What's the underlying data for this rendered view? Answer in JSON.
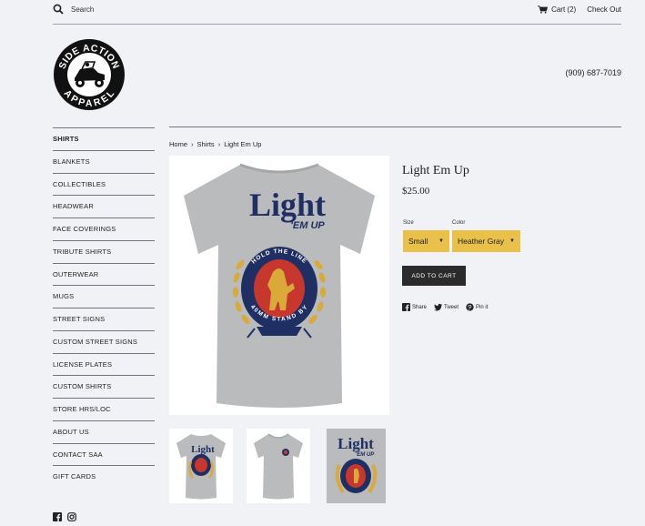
{
  "header": {
    "search_label": "Search",
    "cart_label": "Cart (2)",
    "checkout_label": "Check Out"
  },
  "store": {
    "logo_text_top": "SIDE ACTION",
    "logo_text_bottom": "APPAREL",
    "phone": "(909) 687-7019"
  },
  "sidebar": {
    "items": [
      {
        "label": "SHIRTS",
        "active": true
      },
      {
        "label": "BLANKETS"
      },
      {
        "label": "COLLECTIBLES"
      },
      {
        "label": "HEADWEAR"
      },
      {
        "label": "FACE COVERINGS"
      },
      {
        "label": "TRIBUTE SHIRTS"
      },
      {
        "label": "OUTERWEAR"
      },
      {
        "label": "MUGS"
      },
      {
        "label": "STREET SIGNS"
      },
      {
        "label": "CUSTOM STREET SIGNS"
      },
      {
        "label": "LICENSE PLATES"
      },
      {
        "label": "CUSTOM SHIRTS"
      },
      {
        "label": "STORE HRS/LOC"
      },
      {
        "label": "ABOUT US"
      },
      {
        "label": "CONTACT SAA"
      },
      {
        "label": "GIFT CARDS"
      }
    ],
    "social": [
      "facebook-icon",
      "instagram-icon"
    ]
  },
  "breadcrumb": {
    "home": "Home",
    "sep": "›",
    "category": "Shirts",
    "current": "Light Em Up"
  },
  "product": {
    "title": "Light Em Up",
    "price": "$25.00",
    "graphic_text_main": "Light",
    "graphic_text_sub": "'EM UP",
    "graphic_ring_top": "HOLD THE LINE",
    "graphic_ring_bottom": "40MM STAND BY",
    "size_label": "Size",
    "size_value": "Small",
    "color_label": "Color",
    "color_value": "Heather Gray",
    "add_to_cart": "ADD TO CART"
  },
  "share": {
    "share": "Share",
    "tweet": "Tweet",
    "pin": "Pin it"
  },
  "colors": {
    "background": "#f0f2f5",
    "select_yellow": "#e8c04a",
    "button_dark": "#2b2b2b",
    "tshirt_gray": "#b9bbbd",
    "navy": "#1f2f63",
    "red": "#c8372d",
    "gold": "#d9a93a"
  }
}
